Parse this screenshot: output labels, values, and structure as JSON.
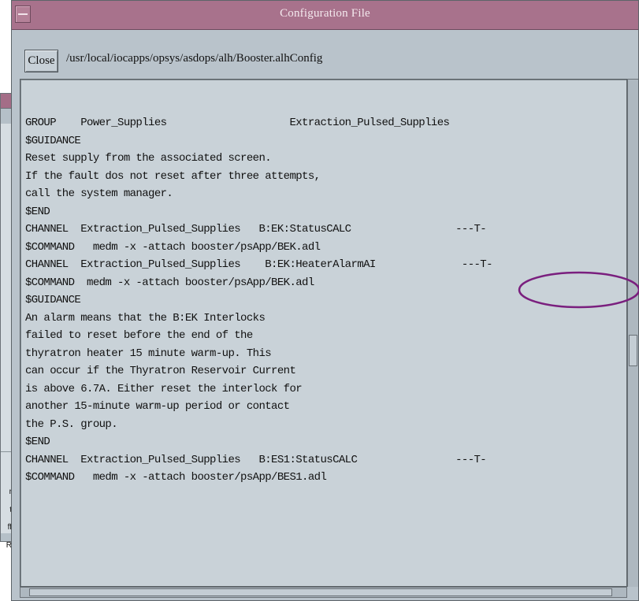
{
  "background_window": {
    "visible_labels": [
      "r",
      "t",
      "ff",
      "R"
    ]
  },
  "window": {
    "title": "Configuration File"
  },
  "toolbar": {
    "close_label": "Close",
    "file_path": "/usr/local/iocapps/opsys/asdops/alh/Booster.alhConfig"
  },
  "config_lines": [
    "GROUP    Power_Supplies                    Extraction_Pulsed_Supplies",
    "$GUIDANCE",
    "Reset supply from the associated screen.",
    "If the fault dos not reset after three attempts,",
    "call the system manager.",
    "$END",
    "CHANNEL  Extraction_Pulsed_Supplies   B:EK:StatusCALC                 ---T-",
    "$COMMAND   medm -x -attach booster/psApp/BEK.adl",
    "CHANNEL  Extraction_Pulsed_Supplies    B:EK:HeaterAlarmAI              ---T-",
    "$COMMAND  medm -x -attach booster/psApp/BEK.adl",
    "$GUIDANCE",
    "An alarm means that the B:EK Interlocks",
    "failed to reset before the end of the",
    "thyratron heater 15 minute warm-up. This",
    "can occur if the Thyratron Reservoir Current",
    "is above 6.7A. Either reset the interlock for",
    "another 15-minute warm-up period or contact",
    "the P.S. group.",
    "$END",
    "CHANNEL  Extraction_Pulsed_Supplies   B:ES1:StatusCALC                ---T-",
    "$COMMAND   medm -x -attach booster/psApp/BES1.adl"
  ],
  "colors": {
    "titlebar": "#a8728c",
    "window_bg": "#b9c3cb",
    "text_area_bg": "#c9d2d8",
    "annotation_ellipse": "#7a1f7e"
  },
  "icons": {
    "window_menu": "window-menu-icon"
  }
}
